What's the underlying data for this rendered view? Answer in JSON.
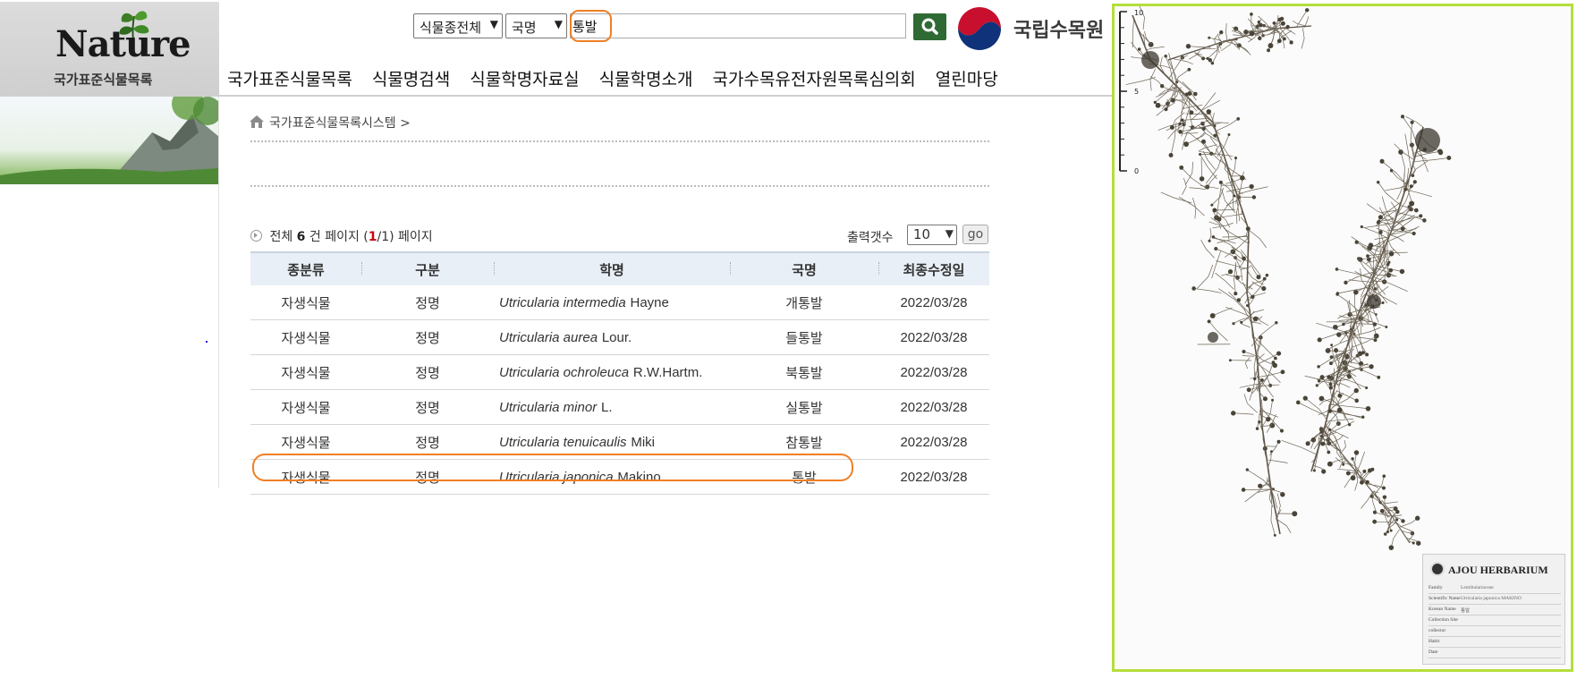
{
  "logo": {
    "word": "Nature",
    "subtitle": "국가표준식물목록"
  },
  "search": {
    "category_select": "식물종전체",
    "field_select": "국명",
    "query": "통발"
  },
  "org": {
    "name": "국립수목원"
  },
  "nav": [
    "국가표준식물목록",
    "식물명검색",
    "식물학명자료실",
    "식물학명소개",
    "국가수목유전자원목록심의회",
    "열린마당"
  ],
  "breadcrumb": "국가표준식물목록시스템 >",
  "summary": {
    "prefix": "전체",
    "total": "6",
    "unit": "건 페이지 (",
    "current": "1",
    "sep": "/1) 페이지"
  },
  "pagination": {
    "count_label": "출력갯수",
    "count_value": "10",
    "go_label": "go"
  },
  "table": {
    "headers": [
      "종분류",
      "구분",
      "학명",
      "국명",
      "최종수정일"
    ],
    "rows": [
      {
        "kind": "자생식물",
        "status": "정명",
        "genus_species": "Utricularia intermedia",
        "author": "Hayne",
        "korean": "개통발",
        "date": "2022/03/28"
      },
      {
        "kind": "자생식물",
        "status": "정명",
        "genus_species": "Utricularia aurea",
        "author": "Lour.",
        "korean": "들통발",
        "date": "2022/03/28"
      },
      {
        "kind": "자생식물",
        "status": "정명",
        "genus_species": "Utricularia ochroleuca",
        "author": "R.W.Hartm.",
        "korean": "북통발",
        "date": "2022/03/28"
      },
      {
        "kind": "자생식물",
        "status": "정명",
        "genus_species": "Utricularia minor",
        "author": "L.",
        "korean": "실통발",
        "date": "2022/03/28"
      },
      {
        "kind": "자생식물",
        "status": "정명",
        "genus_species": "Utricularia tenuicaulis",
        "author": "Miki",
        "korean": "참통발",
        "date": "2022/03/28"
      },
      {
        "kind": "자생식물",
        "status": "정명",
        "genus_species": "Utricularia japonica",
        "author": "Makino",
        "korean": "통발",
        "date": "2022/03/28"
      }
    ]
  },
  "specimen": {
    "herbarium": "AJOU HERBARIUM",
    "scale_top": "10",
    "scale_mid": "5",
    "scale_bottom": "0",
    "label_rows": [
      {
        "k": "Family",
        "v": "Lentibulariaceae"
      },
      {
        "k": "Scientific Name",
        "v": "Utricularia japonica MAKINO"
      },
      {
        "k": "Korean Name",
        "v": "통발"
      },
      {
        "k": "Collection Site",
        "v": ""
      },
      {
        "k": "collector",
        "v": ""
      },
      {
        "k": "Habit",
        "v": ""
      },
      {
        "k": "Date",
        "v": ""
      }
    ]
  },
  "colors": {
    "accent_orange": "#f07f24",
    "search_green": "#2f6a34",
    "panel_border": "#b5de3c",
    "header_bg": "#e9eff7"
  }
}
